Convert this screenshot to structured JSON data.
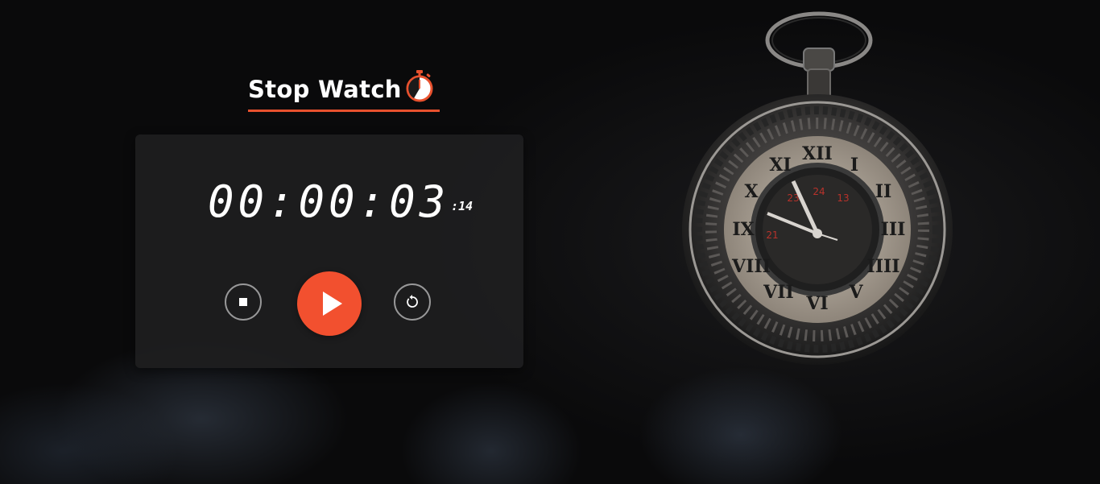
{
  "header": {
    "title": "Stop Watch",
    "icon": "stopwatch-icon",
    "accent_color": "#e8512e"
  },
  "stopwatch": {
    "time_main": "00:00:03",
    "time_ms": ":14"
  },
  "controls": {
    "stop_icon": "stop-icon",
    "play_icon": "play-icon",
    "reset_icon": "reset-icon",
    "play_color": "#f2502f"
  }
}
